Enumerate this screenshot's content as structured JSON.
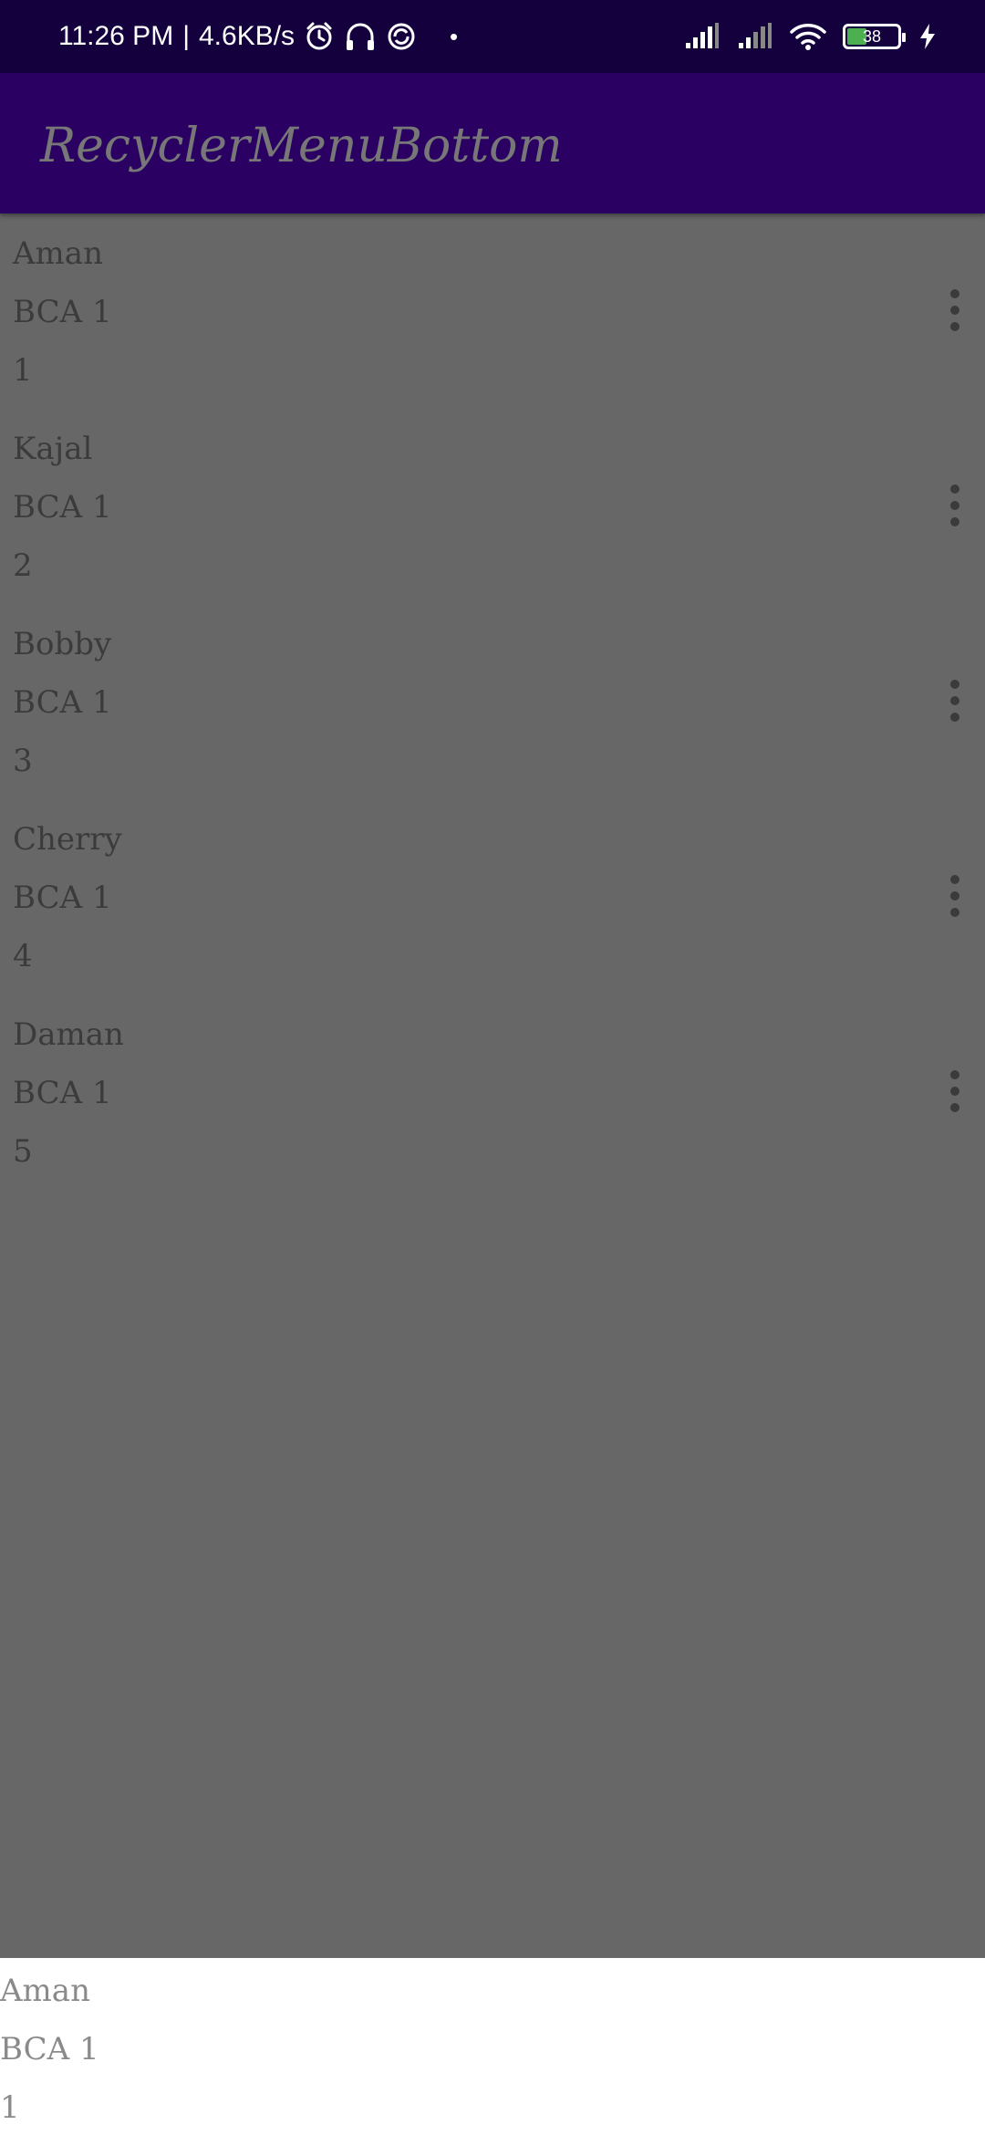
{
  "status_bar": {
    "time": "11:26 PM",
    "separator": "|",
    "network_speed": "4.6KB/s",
    "dot": "•",
    "battery_level": "38",
    "battery_fraction": 0.38,
    "icons": [
      "alarm-icon",
      "headset-icon",
      "sync-icon",
      "signal-icon",
      "wifi-icon",
      "battery-icon",
      "charging-icon"
    ]
  },
  "app_bar": {
    "title": "RecyclerMenuBottom",
    "background": "#2a0062"
  },
  "list": {
    "items": [
      {
        "name": "Aman",
        "class": "BCA 1",
        "roll": "1"
      },
      {
        "name": "Kajal",
        "class": "BCA 1",
        "roll": "2"
      },
      {
        "name": "Bobby",
        "class": "BCA 1",
        "roll": "3"
      },
      {
        "name": "Cherry",
        "class": "BCA 1",
        "roll": "4"
      },
      {
        "name": "Daman",
        "class": "BCA 1",
        "roll": "5"
      }
    ],
    "menu_icon": "more-vert-icon"
  },
  "bottom_sheet": {
    "name": "Aman",
    "class": "BCA 1",
    "roll": "1"
  },
  "colors": {
    "status_bar": "#13003d",
    "app_bar": "#2a0062",
    "scrim": "#676767",
    "sheet": "#ffffff"
  }
}
